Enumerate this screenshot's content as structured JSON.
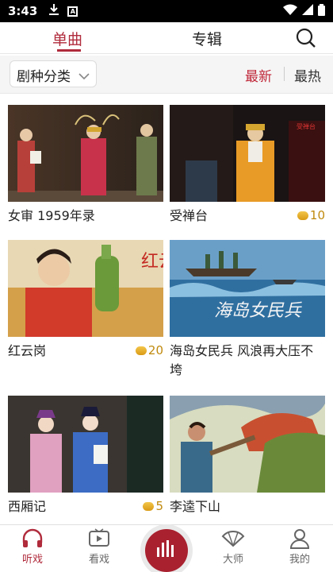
{
  "status_bar": {
    "time": "3:43",
    "notification_box": "A"
  },
  "top_tabs": {
    "singles": "单曲",
    "albums": "专辑"
  },
  "filter": {
    "category": "剧种分类",
    "sort_newest": "最新",
    "sort_hottest": "最热"
  },
  "items": [
    {
      "title": "女审 1959年录",
      "coins": ""
    },
    {
      "title": "受禅台",
      "coins": "10"
    },
    {
      "title": "红云岗",
      "coins": "20"
    },
    {
      "title": "海岛女民兵 风浪再大压不垮",
      "coins": ""
    },
    {
      "title": "西厢记",
      "coins": "5"
    },
    {
      "title": "李逵下山",
      "coins": ""
    }
  ],
  "thumb_text": {
    "poster_1": "红云岗",
    "poster_2": "海岛女民兵",
    "stage_sign": "受禅台"
  },
  "bottom_nav": {
    "listen": "听戏",
    "watch": "看戏",
    "masters": "大师",
    "mine": "我的"
  },
  "colors": {
    "accent": "#b02b3c",
    "coin": "#c08a0e"
  }
}
